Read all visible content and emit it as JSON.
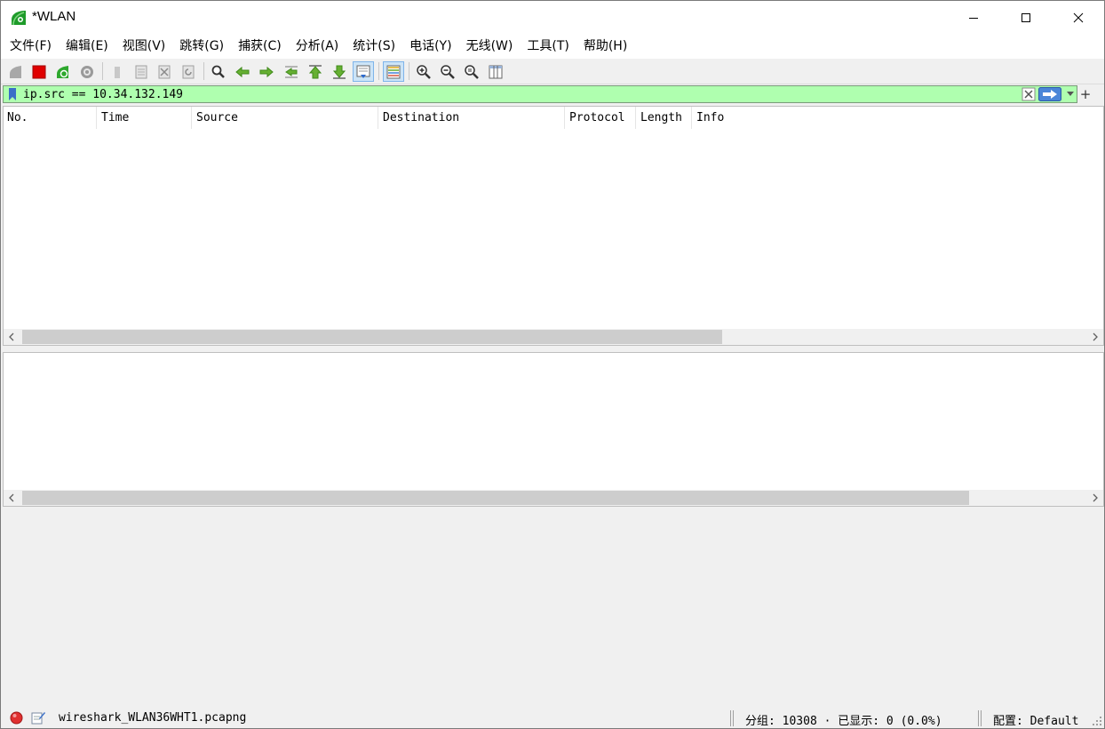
{
  "window": {
    "title": "*WLAN"
  },
  "menu": {
    "items": [
      {
        "label": "文件(F)"
      },
      {
        "label": "编辑(E)"
      },
      {
        "label": "视图(V)"
      },
      {
        "label": "跳转(G)"
      },
      {
        "label": "捕获(C)"
      },
      {
        "label": "分析(A)"
      },
      {
        "label": "统计(S)"
      },
      {
        "label": "电话(Y)"
      },
      {
        "label": "无线(W)"
      },
      {
        "label": "工具(T)"
      },
      {
        "label": "帮助(H)"
      }
    ]
  },
  "toolbar": {
    "icons": [
      "shark-fin-icon",
      "stop-icon",
      "restart-icon",
      "options-gear-icon",
      "open-file-icon",
      "save-file-icon",
      "close-file-icon",
      "reload-icon",
      "find-icon",
      "go-back-icon",
      "go-forward-icon",
      "go-to-packet-icon",
      "first-packet-icon",
      "last-packet-icon",
      "autoscroll-icon",
      "colorize-icon",
      "zoom-in-icon",
      "zoom-out-icon",
      "normal-size-icon",
      "resize-columns-icon"
    ]
  },
  "filter": {
    "value": "ip.src == 10.34.132.149",
    "background_color": "#afffaf",
    "add_label": "+"
  },
  "packet_list": {
    "columns": [
      {
        "label": "No."
      },
      {
        "label": "Time"
      },
      {
        "label": "Source"
      },
      {
        "label": "Destination"
      },
      {
        "label": "Protocol"
      },
      {
        "label": "Length"
      },
      {
        "label": "Info"
      }
    ],
    "rows": []
  },
  "status": {
    "file": "wireshark_WLAN36WHT1.pcapng",
    "packets": "分组: 10308 · 已显示: 0 (0.0%)",
    "profile": "配置: Default"
  }
}
